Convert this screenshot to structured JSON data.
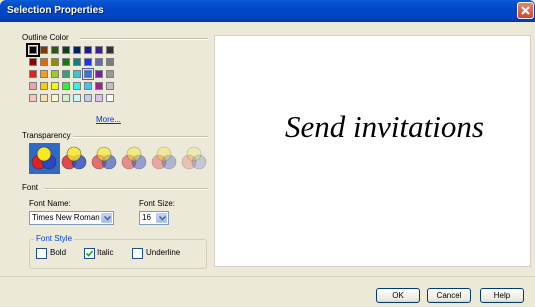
{
  "window": {
    "title": "Selection Properties"
  },
  "outline_color": {
    "label": "Outline Color",
    "more_link": "More...",
    "rows": [
      [
        "#000000",
        "#7a3c00",
        "#2b5a12",
        "#0f3f1f",
        "#001f6b",
        "#1b1b8c",
        "#3b2290",
        "#333333"
      ],
      [
        "#8a0000",
        "#e06a00",
        "#8e8e00",
        "#157a16",
        "#0f7f80",
        "#1c34f0",
        "#6a6aa8",
        "#7d7d7d"
      ],
      [
        "#e8201c",
        "#f0a020",
        "#9cca2a",
        "#3aa07a",
        "#38c8c8",
        "#3d6fe0",
        "#7a1fa0",
        "#9a9a9a"
      ],
      [
        "#f0a0b0",
        "#f8d000",
        "#f8f800",
        "#30f030",
        "#30f0f0",
        "#38c8f8",
        "#a42090",
        "#c0c0c0"
      ],
      [
        "#f8c8b8",
        "#f8e0b0",
        "#f8f8c8",
        "#d0f0d0",
        "#c8f8f8",
        "#b8d0f0",
        "#d8c0f0",
        "#ffffff"
      ]
    ]
  },
  "transparency": {
    "label": "Transparency",
    "levels": [
      "0%",
      "20%",
      "40%",
      "60%",
      "80%",
      "100%"
    ]
  },
  "font": {
    "label": "Font",
    "name_label": "Font Name:",
    "name_value": "Times New Roman",
    "size_label": "Font Size:",
    "size_value": "16",
    "style_label": "Font Style",
    "bold_label": "Bold",
    "italic_label": "Italic",
    "underline_label": "Underline",
    "bold_checked": false,
    "italic_checked": true,
    "underline_checked": false
  },
  "preview": {
    "text": "Send invitations"
  },
  "buttons": {
    "ok": "OK",
    "cancel": "Cancel",
    "help": "Help"
  }
}
